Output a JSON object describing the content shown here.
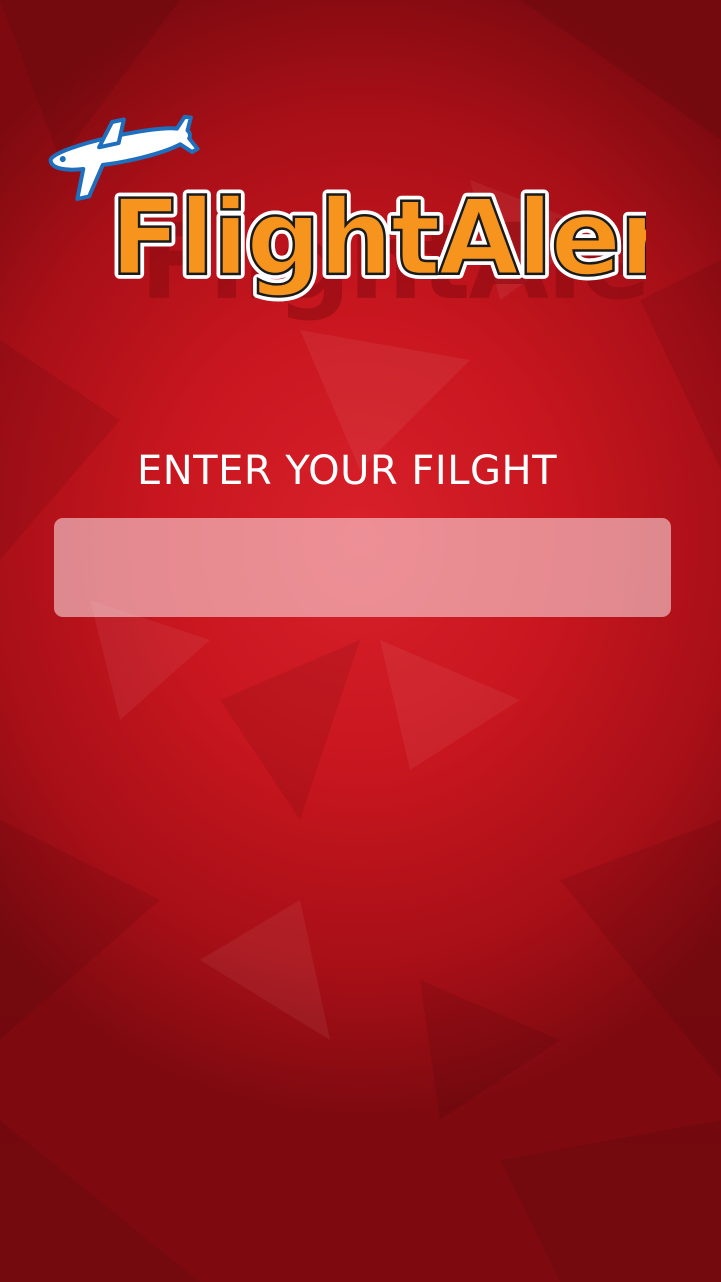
{
  "app": {
    "logo_text": "FlightAlert"
  },
  "form": {
    "prompt_label": "ENTER YOUR FILGHT",
    "flight_input_value": "",
    "flight_input_placeholder": ""
  },
  "colors": {
    "background": "#c8161f",
    "logo_fill": "#f7941d",
    "logo_outline": "#ffffff",
    "plane_body": "#ffffff",
    "plane_outline": "#1f6fbf"
  },
  "icons": {
    "logo_icon": "airplane-icon"
  }
}
